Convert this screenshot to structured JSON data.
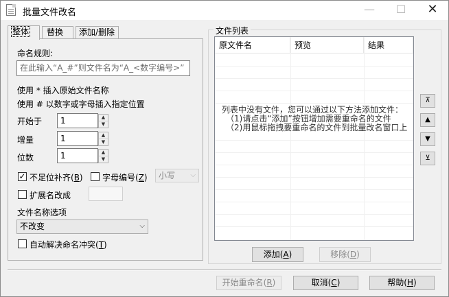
{
  "window": {
    "title": "批量文件改名",
    "min_glyph": "—",
    "max_glyph": "☐",
    "close_glyph": "✕"
  },
  "tabs": [
    {
      "label": "整体",
      "active": true
    },
    {
      "label": "替换",
      "active": false
    },
    {
      "label": "添加/删除",
      "active": false
    }
  ],
  "naming": {
    "rule_label": "命名规则:",
    "rule_placeholder": "在此输入“A_#”则文件名为“A_<数字编号>”",
    "hint1": "使用 * 插入原始文件名称",
    "hint2": "使用 # 以数字或字母插入指定位置"
  },
  "fields": {
    "start_label": "开始于",
    "start_value": "1",
    "increment_label": "增量",
    "increment_value": "1",
    "digits_label": "位数",
    "digits_value": "1"
  },
  "options": {
    "pad_label": "不足位补齐(",
    "pad_key": "B",
    "pad_checked": true,
    "alpha_label": "字母编号(",
    "alpha_key": "Z",
    "alpha_checked": false,
    "case_value": "小写",
    "ext_label": "扩展名改成",
    "ext_checked": false,
    "filename_options_label": "文件名称选项",
    "filename_option_value": "不改变",
    "autoresolve_label": "自动解决命名冲突(",
    "autoresolve_key": "T",
    "autoresolve_checked": false,
    "check_glyph": "✓",
    "dropdown_glyph": "⌵"
  },
  "file_list": {
    "group_title": "文件列表",
    "columns": [
      "原文件名",
      "预览",
      "结果"
    ],
    "empty_line1": "列表中没有文件，您可以通过以下方法添加文件：",
    "empty_line2": "（1)请点击“添加”按钮增加需要重命名的文件",
    "empty_line3": "（2)用鼠标拖拽要重命名的文件到批量改名窗口上",
    "add_label": "添加(",
    "add_key": "A",
    "remove_label": "移除(",
    "remove_key": "D"
  },
  "side_buttons": [
    "⊼",
    "▲",
    "▼",
    "⊻"
  ],
  "footer": {
    "start_label": "开始重命名(",
    "start_key": "R",
    "cancel_label": "取消(",
    "cancel_key": "C",
    "help_label": "帮助(",
    "help_key": "H",
    "close_paren": ")"
  }
}
